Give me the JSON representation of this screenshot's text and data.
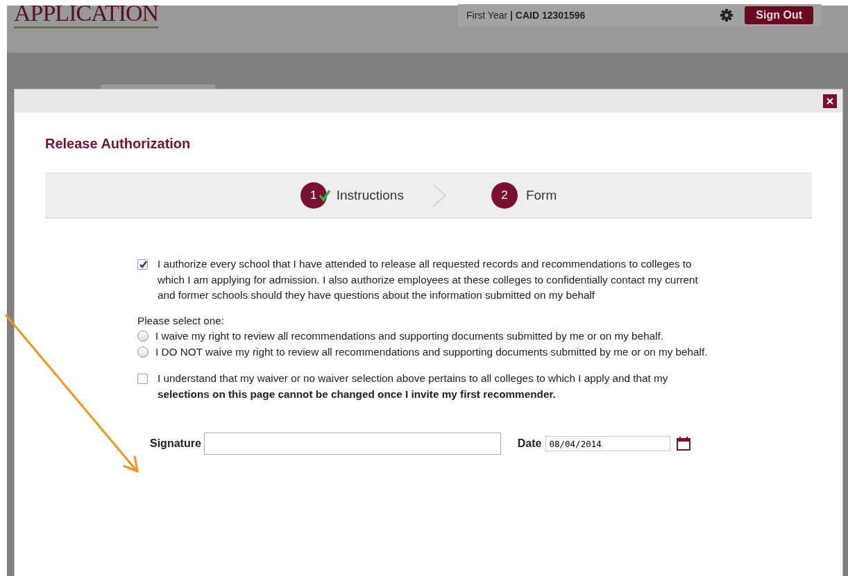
{
  "header": {
    "logo": "APPLICATION",
    "user_info": "First Year **| CAID 12301596**",
    "sign_out": "Sign Out"
  },
  "modal": {
    "title": "Release Authorization",
    "steps": [
      {
        "number": "1",
        "label": "Instructions",
        "completed": true
      },
      {
        "number": "2",
        "label": "Form",
        "completed": false
      }
    ],
    "authorization": {
      "text": "I authorize every school that I have attended to release all requested records and recommendations to colleges to which I am applying for admission. I also authorize employees at these colleges to confidentially contact my current and former schools should they have questions about the information submitted on my behalf",
      "checked": true
    },
    "prompt": "Please select one:",
    "waiver_options": [
      {
        "label": "I waive my right to review all recommendations and supporting documents submitted by me or on my behalf.",
        "selected": false
      },
      {
        "label": "I DO NOT waive my right to review all recommendations and supporting documents submitted by me or on my behalf.",
        "selected": false
      }
    ],
    "acknowledgement": {
      "text": "I understand that my waiver or no waiver selection above pertains to all colleges to which I apply and that my **selections on this page cannot be changed once I invite my first recommender.**",
      "checked": false
    },
    "signature": {
      "label": "Signature"
    },
    "date": {
      "label": "Date",
      "value": "08/04/2014"
    }
  }
}
